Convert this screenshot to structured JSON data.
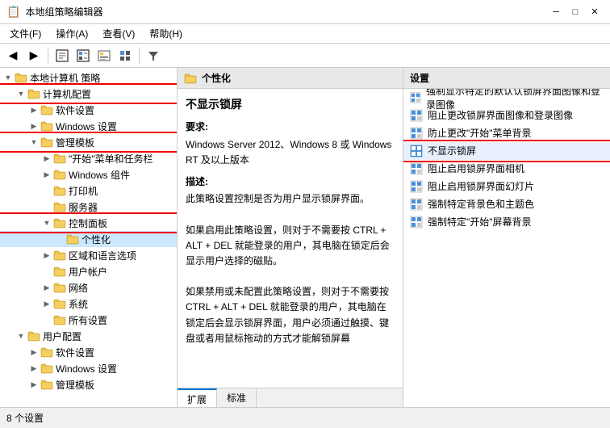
{
  "window": {
    "title": "本地组策略编辑器",
    "icon": "📋"
  },
  "menu": {
    "items": [
      "文件(F)",
      "操作(A)",
      "查看(V)",
      "帮助(H)"
    ]
  },
  "toolbar": {
    "buttons": [
      "◀",
      "▶",
      "⬆",
      "📋",
      "📋",
      "📋",
      "📋",
      "🔽"
    ]
  },
  "tree": {
    "root_label": "本地计算机 策略",
    "items": [
      {
        "id": "computer-config",
        "label": "计算机配置",
        "indent": 1,
        "expanded": true,
        "highlighted": true
      },
      {
        "id": "software-settings",
        "label": "软件设置",
        "indent": 2,
        "expanded": false,
        "highlighted": false
      },
      {
        "id": "windows-settings",
        "label": "Windows 设置",
        "indent": 2,
        "expanded": false,
        "highlighted": false
      },
      {
        "id": "admin-templates",
        "label": "管理模板",
        "indent": 2,
        "expanded": true,
        "highlighted": true
      },
      {
        "id": "start-taskbar",
        "label": "\"开始\"菜单和任务栏",
        "indent": 3,
        "expanded": false,
        "highlighted": false
      },
      {
        "id": "windows-comp",
        "label": "Windows 组件",
        "indent": 3,
        "expanded": false,
        "highlighted": false
      },
      {
        "id": "printer",
        "label": "打印机",
        "indent": 3,
        "expanded": false,
        "highlighted": false
      },
      {
        "id": "server",
        "label": "服务器",
        "indent": 3,
        "expanded": false,
        "highlighted": false
      },
      {
        "id": "control-panel",
        "label": "控制面板",
        "indent": 3,
        "expanded": true,
        "highlighted": true
      },
      {
        "id": "personalization",
        "label": "个性化",
        "indent": 4,
        "expanded": false,
        "highlighted": false,
        "selected": true
      },
      {
        "id": "region-lang",
        "label": "区域和语言选项",
        "indent": 3,
        "expanded": false,
        "highlighted": false
      },
      {
        "id": "user-accounts",
        "label": "用户帐户",
        "indent": 3,
        "expanded": false,
        "highlighted": false
      },
      {
        "id": "network",
        "label": "网络",
        "indent": 3,
        "expanded": false,
        "highlighted": false
      },
      {
        "id": "system",
        "label": "系统",
        "indent": 3,
        "expanded": false,
        "highlighted": false
      },
      {
        "id": "all-settings",
        "label": "所有设置",
        "indent": 3,
        "expanded": false,
        "highlighted": false
      },
      {
        "id": "user-config",
        "label": "用户配置",
        "indent": 1,
        "expanded": true,
        "highlighted": false
      },
      {
        "id": "user-software",
        "label": "软件设置",
        "indent": 2,
        "expanded": false,
        "highlighted": false
      },
      {
        "id": "user-windows",
        "label": "Windows 设置",
        "indent": 2,
        "expanded": false,
        "highlighted": false
      },
      {
        "id": "user-admin",
        "label": "管理模板",
        "indent": 2,
        "expanded": false,
        "highlighted": false
      }
    ]
  },
  "middle": {
    "header": "个性化",
    "title": "不显示锁屏",
    "require_label": "要求:",
    "require_text": "Windows Server 2012、Windows 8 或 Windows RT 及以上版本",
    "desc_label": "描述:",
    "desc_text": "此策略设置控制是否为用户显示锁屏界面。\n\n如果启用此策略设置，则对于不需要按 CTRL + ALT + DEL 就能登录的用户，其电脑在锁定后会显示用户选择的磁贴。\n\n如果禁用或未配置此策略设置，则对于不需要按 CTRL + ALT + DEL 就能登录的用户，其电脑在锁定后会显示锁屏界面，用户必须通过触摸、键盘或者用鼠标拖动的方式才能解锁屏幕",
    "tabs": [
      "扩展",
      "标准"
    ]
  },
  "right": {
    "header": "设置",
    "items": [
      {
        "id": "force-lockscreen-img",
        "label": "强制显示特定的默认认锁屏界面图像和登录图像",
        "highlighted": false
      },
      {
        "id": "prevent-lockscreen-img",
        "label": "阻止更改锁屏界面图像和登录图像",
        "highlighted": false
      },
      {
        "id": "prevent-start-menu",
        "label": "防止更改\"开始\"菜单背景",
        "highlighted": false
      },
      {
        "id": "no-lockscreen",
        "label": "不显示锁屏",
        "highlighted": true
      },
      {
        "id": "disable-lockscreen-camera",
        "label": "阻止启用锁屏界面相机",
        "highlighted": false
      },
      {
        "id": "disable-lockscreen-slideshow",
        "label": "阻止启用锁屏界面幻灯片",
        "highlighted": false
      },
      {
        "id": "force-bg-color",
        "label": "强制特定背景色和主题色",
        "highlighted": false
      },
      {
        "id": "force-start-bg",
        "label": "强制特定\"开始\"屏幕背景",
        "highlighted": false
      }
    ]
  },
  "status_bar": {
    "text": "8 个设置"
  }
}
